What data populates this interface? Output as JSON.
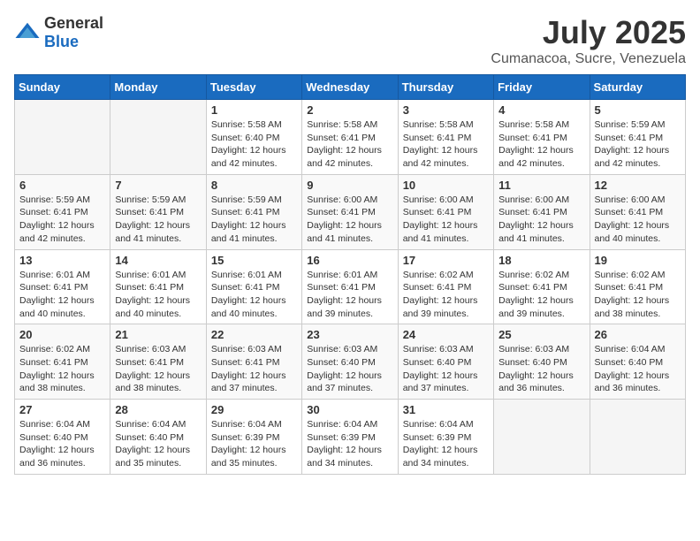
{
  "header": {
    "logo_general": "General",
    "logo_blue": "Blue",
    "month": "July 2025",
    "location": "Cumanacoa, Sucre, Venezuela"
  },
  "days_of_week": [
    "Sunday",
    "Monday",
    "Tuesday",
    "Wednesday",
    "Thursday",
    "Friday",
    "Saturday"
  ],
  "weeks": [
    [
      {
        "day": "",
        "info": ""
      },
      {
        "day": "",
        "info": ""
      },
      {
        "day": "1",
        "info": "Sunrise: 5:58 AM\nSunset: 6:40 PM\nDaylight: 12 hours and 42 minutes."
      },
      {
        "day": "2",
        "info": "Sunrise: 5:58 AM\nSunset: 6:41 PM\nDaylight: 12 hours and 42 minutes."
      },
      {
        "day": "3",
        "info": "Sunrise: 5:58 AM\nSunset: 6:41 PM\nDaylight: 12 hours and 42 minutes."
      },
      {
        "day": "4",
        "info": "Sunrise: 5:58 AM\nSunset: 6:41 PM\nDaylight: 12 hours and 42 minutes."
      },
      {
        "day": "5",
        "info": "Sunrise: 5:59 AM\nSunset: 6:41 PM\nDaylight: 12 hours and 42 minutes."
      }
    ],
    [
      {
        "day": "6",
        "info": "Sunrise: 5:59 AM\nSunset: 6:41 PM\nDaylight: 12 hours and 42 minutes."
      },
      {
        "day": "7",
        "info": "Sunrise: 5:59 AM\nSunset: 6:41 PM\nDaylight: 12 hours and 41 minutes."
      },
      {
        "day": "8",
        "info": "Sunrise: 5:59 AM\nSunset: 6:41 PM\nDaylight: 12 hours and 41 minutes."
      },
      {
        "day": "9",
        "info": "Sunrise: 6:00 AM\nSunset: 6:41 PM\nDaylight: 12 hours and 41 minutes."
      },
      {
        "day": "10",
        "info": "Sunrise: 6:00 AM\nSunset: 6:41 PM\nDaylight: 12 hours and 41 minutes."
      },
      {
        "day": "11",
        "info": "Sunrise: 6:00 AM\nSunset: 6:41 PM\nDaylight: 12 hours and 41 minutes."
      },
      {
        "day": "12",
        "info": "Sunrise: 6:00 AM\nSunset: 6:41 PM\nDaylight: 12 hours and 40 minutes."
      }
    ],
    [
      {
        "day": "13",
        "info": "Sunrise: 6:01 AM\nSunset: 6:41 PM\nDaylight: 12 hours and 40 minutes."
      },
      {
        "day": "14",
        "info": "Sunrise: 6:01 AM\nSunset: 6:41 PM\nDaylight: 12 hours and 40 minutes."
      },
      {
        "day": "15",
        "info": "Sunrise: 6:01 AM\nSunset: 6:41 PM\nDaylight: 12 hours and 40 minutes."
      },
      {
        "day": "16",
        "info": "Sunrise: 6:01 AM\nSunset: 6:41 PM\nDaylight: 12 hours and 39 minutes."
      },
      {
        "day": "17",
        "info": "Sunrise: 6:02 AM\nSunset: 6:41 PM\nDaylight: 12 hours and 39 minutes."
      },
      {
        "day": "18",
        "info": "Sunrise: 6:02 AM\nSunset: 6:41 PM\nDaylight: 12 hours and 39 minutes."
      },
      {
        "day": "19",
        "info": "Sunrise: 6:02 AM\nSunset: 6:41 PM\nDaylight: 12 hours and 38 minutes."
      }
    ],
    [
      {
        "day": "20",
        "info": "Sunrise: 6:02 AM\nSunset: 6:41 PM\nDaylight: 12 hours and 38 minutes."
      },
      {
        "day": "21",
        "info": "Sunrise: 6:03 AM\nSunset: 6:41 PM\nDaylight: 12 hours and 38 minutes."
      },
      {
        "day": "22",
        "info": "Sunrise: 6:03 AM\nSunset: 6:41 PM\nDaylight: 12 hours and 37 minutes."
      },
      {
        "day": "23",
        "info": "Sunrise: 6:03 AM\nSunset: 6:40 PM\nDaylight: 12 hours and 37 minutes."
      },
      {
        "day": "24",
        "info": "Sunrise: 6:03 AM\nSunset: 6:40 PM\nDaylight: 12 hours and 37 minutes."
      },
      {
        "day": "25",
        "info": "Sunrise: 6:03 AM\nSunset: 6:40 PM\nDaylight: 12 hours and 36 minutes."
      },
      {
        "day": "26",
        "info": "Sunrise: 6:04 AM\nSunset: 6:40 PM\nDaylight: 12 hours and 36 minutes."
      }
    ],
    [
      {
        "day": "27",
        "info": "Sunrise: 6:04 AM\nSunset: 6:40 PM\nDaylight: 12 hours and 36 minutes."
      },
      {
        "day": "28",
        "info": "Sunrise: 6:04 AM\nSunset: 6:40 PM\nDaylight: 12 hours and 35 minutes."
      },
      {
        "day": "29",
        "info": "Sunrise: 6:04 AM\nSunset: 6:39 PM\nDaylight: 12 hours and 35 minutes."
      },
      {
        "day": "30",
        "info": "Sunrise: 6:04 AM\nSunset: 6:39 PM\nDaylight: 12 hours and 34 minutes."
      },
      {
        "day": "31",
        "info": "Sunrise: 6:04 AM\nSunset: 6:39 PM\nDaylight: 12 hours and 34 minutes."
      },
      {
        "day": "",
        "info": ""
      },
      {
        "day": "",
        "info": ""
      }
    ]
  ]
}
